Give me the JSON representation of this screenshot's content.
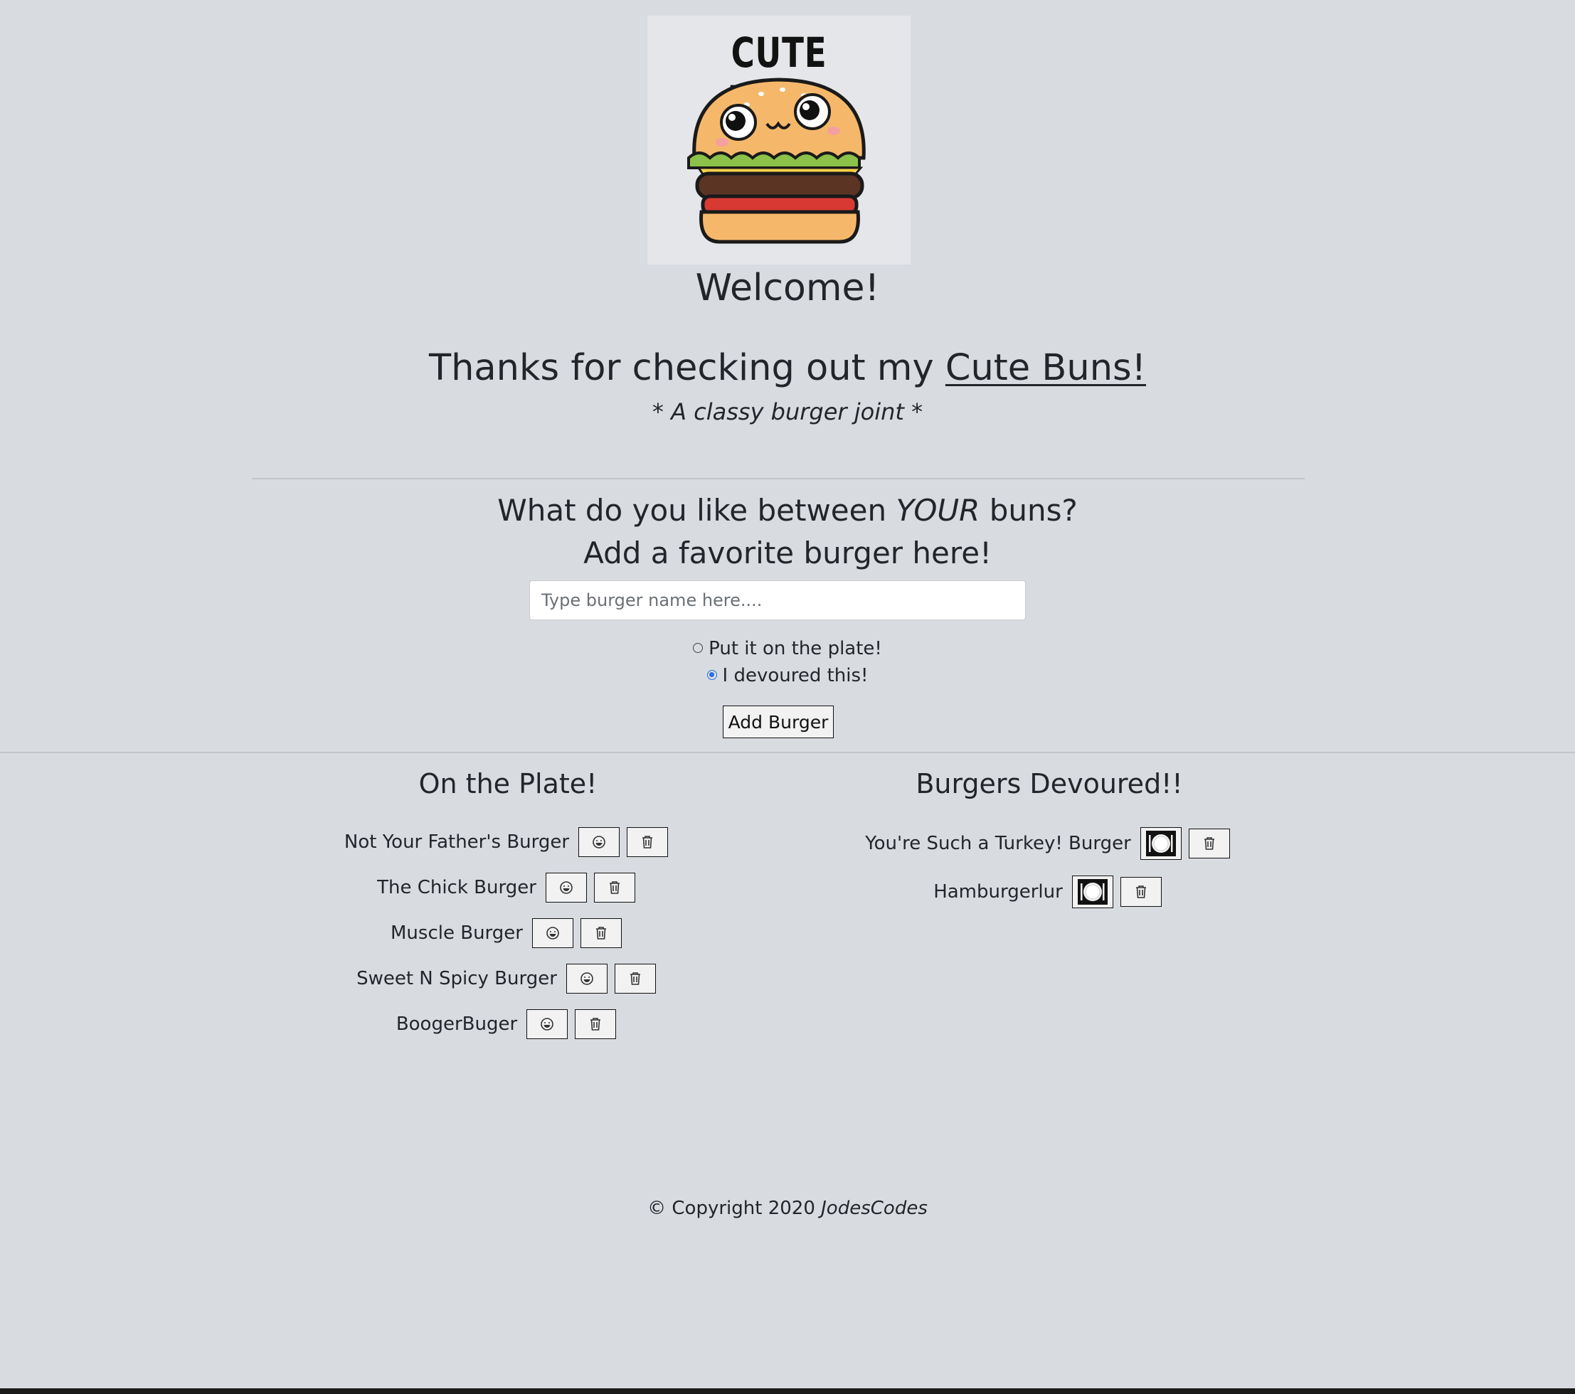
{
  "header": {
    "logo_text": "CUTE BUNS",
    "welcome": "Welcome!",
    "thanks_prefix": "Thanks for checking out my ",
    "thanks_link": "Cute Buns!",
    "tagline": "* A classy burger joint *"
  },
  "form": {
    "question_prefix": "What do you like between ",
    "question_emphasis": "YOUR",
    "question_suffix": " buns?",
    "subtitle": "Add a favorite burger here!",
    "input_placeholder": "Type burger name here....",
    "radio_plate_label": "Put it on the plate!",
    "radio_devoured_label": "I devoured this!",
    "selected_radio": "I devoured this!",
    "submit_label": "Add Burger"
  },
  "plate": {
    "title": "On the Plate!",
    "items": [
      "Not Your Father's Burger",
      "The Chick Burger",
      "Muscle Burger",
      "Sweet N Spicy Burger",
      "BoogerBuger"
    ]
  },
  "devoured": {
    "title": "Burgers Devoured!!",
    "items": [
      "You're Such a Turkey! Burger",
      "Hamburgerlur"
    ]
  },
  "footer": {
    "copyright": "© Copyright 2020",
    "author": "JodesCodes"
  },
  "icons": {
    "eat_button": "grin-icon",
    "delete_button": "trash-icon",
    "devoured_button": "plate-icon"
  }
}
